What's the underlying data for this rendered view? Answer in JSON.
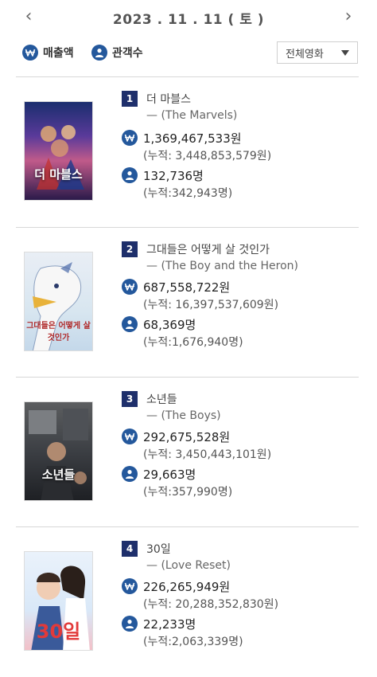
{
  "header": {
    "date": "2023 . 11 . 11 ( 토 )",
    "prev_icon": "chevron-left-icon",
    "next_icon": "chevron-right-icon"
  },
  "legend": {
    "sales_icon": "won-icon",
    "sales_label": "매출액",
    "audience_icon": "person-icon",
    "audience_label": "관객수"
  },
  "filter": {
    "selected": "전체영화"
  },
  "colors": {
    "accent": "#24589c",
    "rank_badge": "#1e2f6b",
    "divider": "#d7d7d7"
  },
  "movies": [
    {
      "rank": "1",
      "title_kr": "더 마블스",
      "title_en": "— (The Marvels)",
      "sales": "1,369,467,533원",
      "sales_total": "(누적: 3,448,853,579원)",
      "audience": "132,736명",
      "audience_total": "(누적:342,943명)",
      "poster_text": "더 마블스"
    },
    {
      "rank": "2",
      "title_kr": "그대들은 어떻게 살 것인가",
      "title_en": "— (The Boy and the Heron)",
      "sales": "687,558,722원",
      "sales_total": "(누적: 16,397,537,609원)",
      "audience": "68,369명",
      "audience_total": "(누적:1,676,940명)",
      "poster_text": "그대들은 어떻게 살것인가"
    },
    {
      "rank": "3",
      "title_kr": "소년들",
      "title_en": "— (The Boys)",
      "sales": "292,675,528원",
      "sales_total": "(누적: 3,450,443,101원)",
      "audience": "29,663명",
      "audience_total": "(누적:357,990명)",
      "poster_text": "소년들"
    },
    {
      "rank": "4",
      "title_kr": "30일",
      "title_en": "— (Love Reset)",
      "sales": "226,265,949원",
      "sales_total": "(누적: 20,288,352,830원)",
      "audience": "22,233명",
      "audience_total": "(누적:2,063,339명)",
      "poster_text": "30일"
    }
  ]
}
